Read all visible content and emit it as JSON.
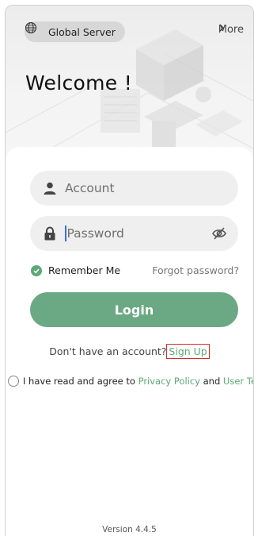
{
  "header": {
    "server_label": "Global Server",
    "more_label": "More",
    "welcome_title": "Welcome !"
  },
  "form": {
    "account_placeholder": "Account",
    "password_placeholder": "Password",
    "remember_label": "Remember Me",
    "remember_checked": true,
    "forgot_label": "Forgot password?",
    "login_label": "Login"
  },
  "signup": {
    "prompt": "Don't have an account?",
    "link": "Sign Up"
  },
  "agreement": {
    "prefix": "I have read and agree to",
    "privacy_link": "Privacy Policy",
    "conjunction": "and",
    "terms_link": "User Terms",
    "checked": false
  },
  "footer": {
    "version": "Version 4.4.5"
  },
  "colors": {
    "accent": "#6aa983",
    "link": "#5fa878",
    "highlight_border": "#d32f2f"
  },
  "icons": [
    "globe-icon",
    "chevron-right-icon",
    "user-icon",
    "lock-icon",
    "eye-off-icon",
    "check-icon"
  ]
}
